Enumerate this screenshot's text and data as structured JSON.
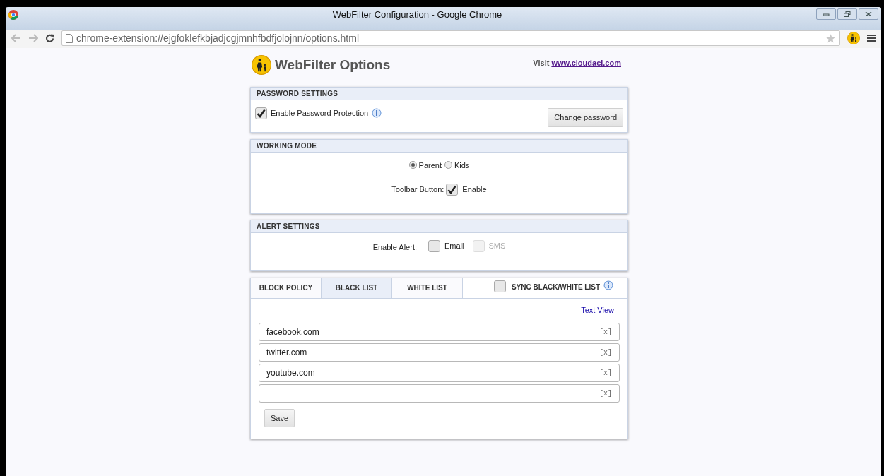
{
  "window": {
    "title": "WebFilter Configuration - Google Chrome"
  },
  "address_bar": {
    "url": "chrome-extension://ejgfoklefkbjadjcgjmnhfbdfjolojnn/options.html"
  },
  "header": {
    "title": "WebFilter Options",
    "visit_label": "Visit",
    "visit_link": "www.cloudacl.com"
  },
  "password_settings": {
    "heading": "PASSWORD SETTINGS",
    "enable": {
      "label": "Enable Password Protection",
      "checked": true
    },
    "button": "Change password"
  },
  "working_mode": {
    "heading": "WORKING MODE",
    "modes": [
      {
        "label": "Parent",
        "selected": true
      },
      {
        "label": "Kids",
        "selected": false
      }
    ],
    "toolbar_label": "Toolbar Button:",
    "toolbar": {
      "label": "Enable",
      "checked": true
    }
  },
  "alert_settings": {
    "heading": "ALERT SETTINGS",
    "label": "Enable Alert:",
    "options": [
      {
        "label": "Email",
        "checked": false,
        "disabled": false
      },
      {
        "label": "SMS",
        "checked": false,
        "disabled": true
      }
    ]
  },
  "lists": {
    "tabs": [
      {
        "label": "BLOCK POLICY",
        "selected": false
      },
      {
        "label": "BLACK LIST",
        "selected": true
      },
      {
        "label": "WHITE LIST",
        "selected": false
      }
    ],
    "sync": {
      "label": "SYNC BLACK/WHITE LIST",
      "checked": false
    },
    "text_view": "Text View",
    "entries": [
      {
        "value": "facebook.com",
        "remove": "[x]"
      },
      {
        "value": "twitter.com",
        "remove": "[x]"
      },
      {
        "value": "youtube.com",
        "remove": "[x]"
      },
      {
        "remove": "[x]"
      }
    ],
    "save": "Save"
  }
}
